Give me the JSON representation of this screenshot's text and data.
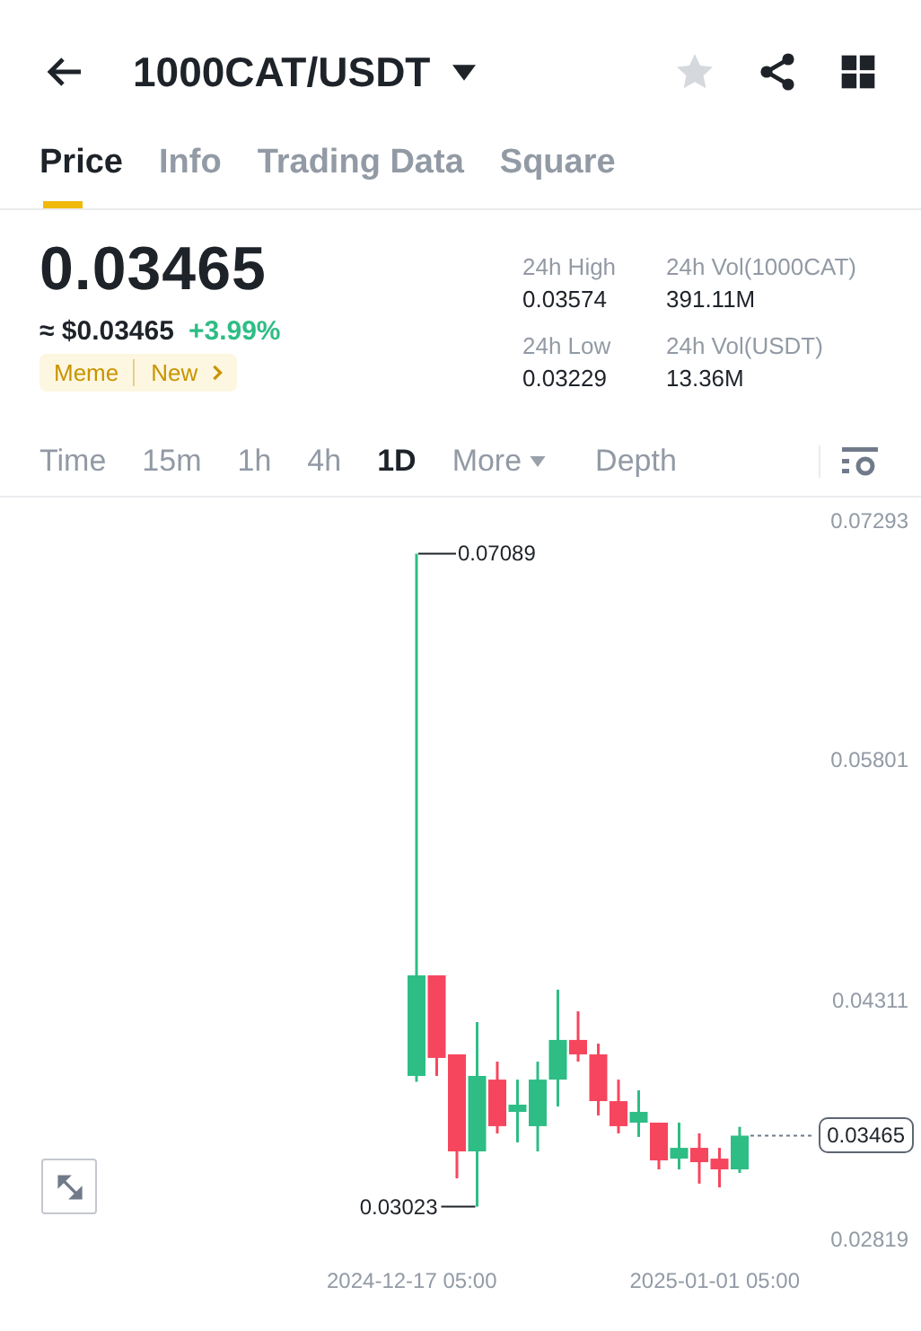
{
  "header": {
    "title": "1000CAT/USDT",
    "favorite": false
  },
  "tabs": [
    {
      "label": "Price",
      "selected": true
    },
    {
      "label": "Info",
      "selected": false
    },
    {
      "label": "Trading Data",
      "selected": false
    },
    {
      "label": "Square",
      "selected": false
    }
  ],
  "price": {
    "last": "0.03465",
    "fiat": "≈ $0.03465",
    "change": "+3.99%",
    "tags": [
      "Meme",
      "New"
    ]
  },
  "stats": [
    {
      "label": "24h High",
      "value": "0.03574"
    },
    {
      "label": "24h Vol(1000CAT)",
      "value": "391.11M"
    },
    {
      "label": "24h Low",
      "value": "0.03229"
    },
    {
      "label": "24h Vol(USDT)",
      "value": "13.36M"
    }
  ],
  "intervals": [
    {
      "label": "Time",
      "selected": false
    },
    {
      "label": "15m",
      "selected": false
    },
    {
      "label": "1h",
      "selected": false
    },
    {
      "label": "4h",
      "selected": false
    },
    {
      "label": "1D",
      "selected": true
    },
    {
      "label": "More",
      "selected": false,
      "dropdown": true
    },
    {
      "label": "Depth",
      "selected": false
    }
  ],
  "chart": {
    "high_label": "0.07089",
    "low_label": "0.03023",
    "last_price": "0.03465",
    "chart_data": {
      "type": "candlestick",
      "categories": [
        "2024-12-17 05:00",
        null,
        null,
        null,
        null,
        null,
        null,
        null,
        null,
        null,
        null,
        null,
        null,
        null,
        null,
        "2025-01-01 05:00",
        null
      ],
      "ohlc": [
        [
          0.03837,
          0.07089,
          0.038,
          0.04463
        ],
        [
          0.04463,
          0.04463,
          0.03837,
          0.03949
        ],
        [
          0.03971,
          0.03971,
          0.03199,
          0.03367
        ],
        [
          0.03367,
          0.04172,
          0.03023,
          0.03837
        ],
        [
          0.03814,
          0.03926,
          0.03479,
          0.03524
        ],
        [
          0.03613,
          0.03814,
          0.03423,
          0.03658
        ],
        [
          0.03524,
          0.03926,
          0.03367,
          0.03814
        ],
        [
          0.03814,
          0.04374,
          0.03647,
          0.04061
        ],
        [
          0.04061,
          0.04239,
          0.03926,
          0.03971
        ],
        [
          0.03971,
          0.04038,
          0.03591,
          0.0368
        ],
        [
          0.0368,
          0.03814,
          0.03479,
          0.03524
        ],
        [
          0.03546,
          0.03747,
          0.03457,
          0.03613
        ],
        [
          0.03546,
          0.03546,
          0.03255,
          0.03311
        ],
        [
          0.03322,
          0.03546,
          0.03255,
          0.03389
        ],
        [
          0.03389,
          0.03479,
          0.03166,
          0.033
        ],
        [
          0.03322,
          0.03389,
          0.03143,
          0.03255
        ],
        [
          0.03255,
          0.0352,
          0.03233,
          0.03465
        ]
      ],
      "ylim": [
        0.02819,
        0.07293
      ],
      "yticks": [
        0.07293,
        0.05801,
        0.04311,
        0.02819
      ]
    }
  }
}
